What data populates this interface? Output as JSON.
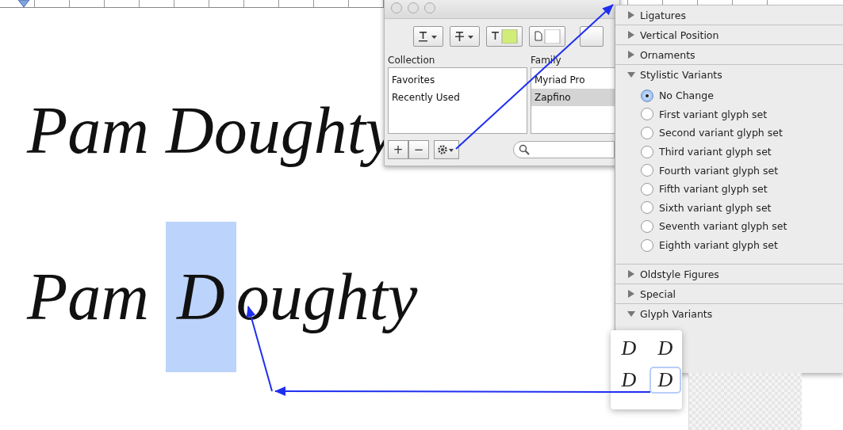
{
  "document": {
    "lines": [
      {
        "segments": [
          {
            "text": "Pam Doughty",
            "selected": false
          }
        ]
      },
      {
        "segments": [
          {
            "text": "Pam ",
            "selected": false
          },
          {
            "text": "D",
            "selected": true
          },
          {
            "text": "oughty",
            "selected": false
          }
        ]
      }
    ]
  },
  "font_panel": {
    "collection_header": "Collection",
    "collections": [
      {
        "label": "Favorites",
        "selected": false
      },
      {
        "label": "Recently Used",
        "selected": false
      }
    ],
    "family_header": "Family",
    "families": [
      {
        "label": "Myriad Pro",
        "selected": false
      },
      {
        "label": "Zapfino",
        "selected": true
      }
    ],
    "buttons": [
      "+",
      "−"
    ]
  },
  "typography": {
    "sections": [
      {
        "label": "Ligatures",
        "expanded": false
      },
      {
        "label": "Vertical Position",
        "expanded": false
      },
      {
        "label": "Ornaments",
        "expanded": false
      },
      {
        "label": "Stylistic Variants",
        "expanded": true,
        "options": [
          {
            "label": "No Change",
            "selected": true
          },
          {
            "label": "First variant glyph set",
            "selected": false
          },
          {
            "label": "Second variant glyph set",
            "selected": false
          },
          {
            "label": "Third variant glyph set",
            "selected": false
          },
          {
            "label": "Fourth variant glyph set",
            "selected": false
          },
          {
            "label": "Fifth variant glyph set",
            "selected": false
          },
          {
            "label": "Sixth variant glyph set",
            "selected": false
          },
          {
            "label": "Seventh variant glyph set",
            "selected": false
          },
          {
            "label": "Eighth variant glyph set",
            "selected": false
          }
        ]
      },
      {
        "label": "Oldstyle Figures",
        "expanded": false
      },
      {
        "label": "Special",
        "expanded": false
      },
      {
        "label": "Glyph Variants",
        "expanded": true
      }
    ]
  },
  "glyph_variants": [
    {
      "glyph": "D",
      "selected": false
    },
    {
      "glyph": "D",
      "selected": false
    },
    {
      "glyph": "D",
      "selected": false
    },
    {
      "glyph": "D",
      "selected": true
    }
  ]
}
